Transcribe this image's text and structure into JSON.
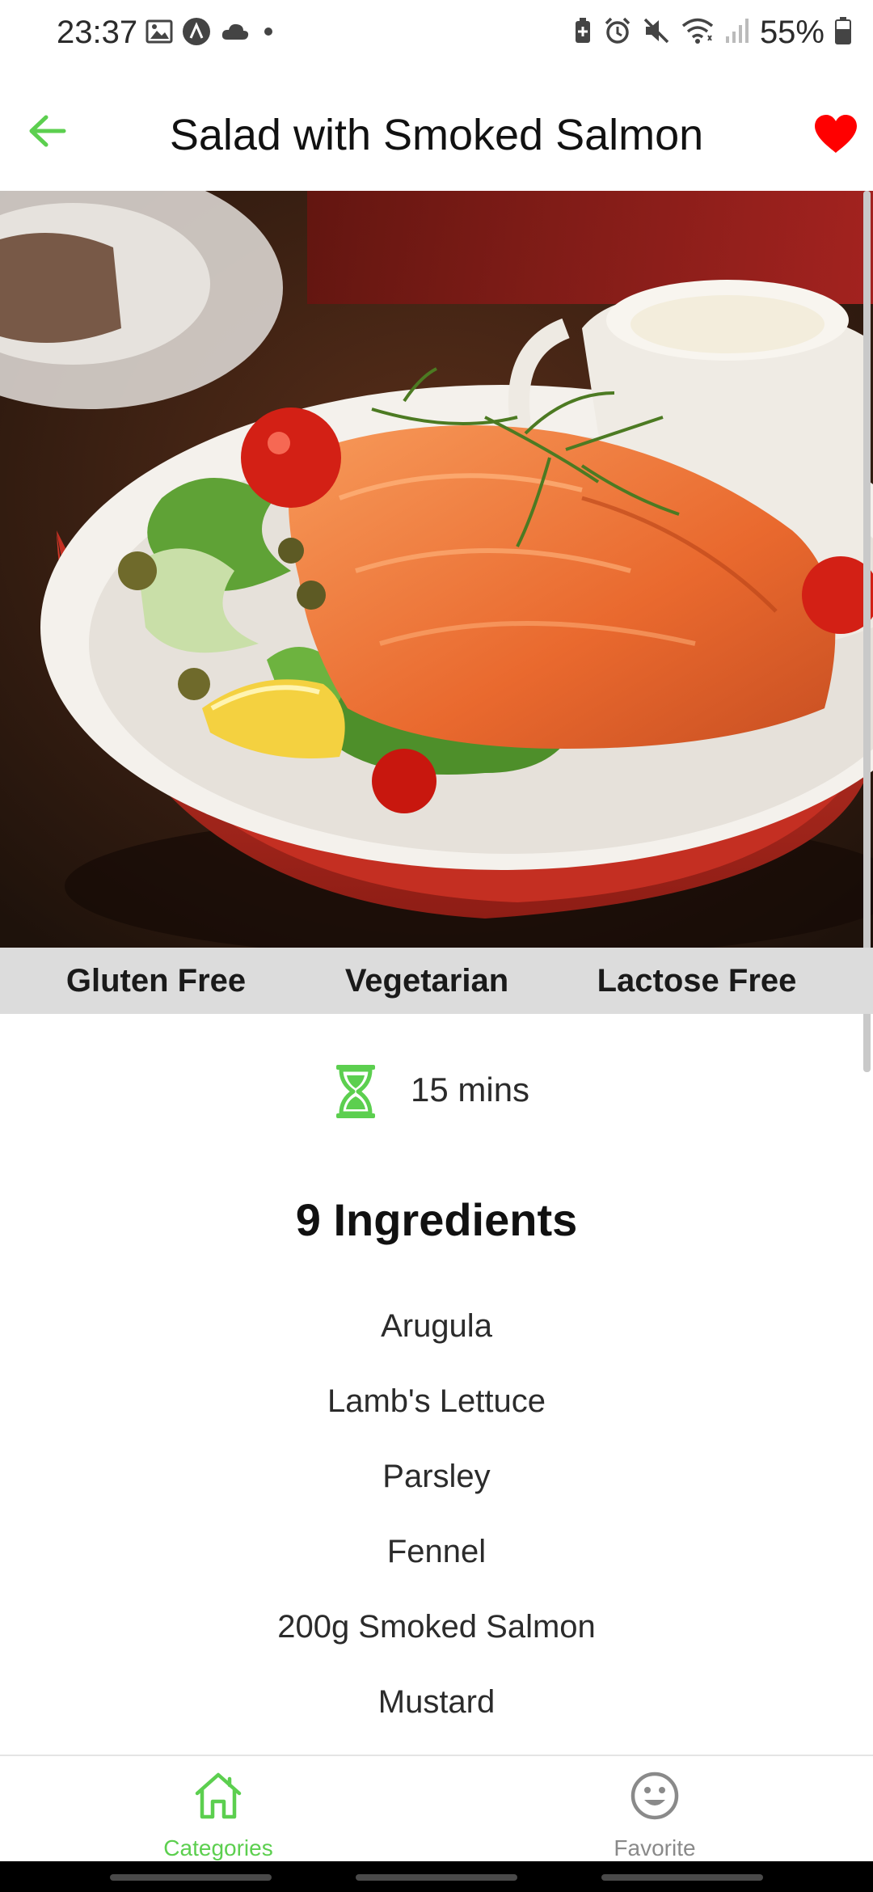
{
  "status_bar": {
    "time": "23:37",
    "battery_text": "55%",
    "left_icons": [
      "image-icon",
      "circle-a-icon",
      "cloud-icon",
      "dot-icon"
    ],
    "right_icons": [
      "battery-saver-icon",
      "alarm-icon",
      "mute-icon",
      "wifi-icon",
      "signal-icon",
      "battery-icon"
    ]
  },
  "app_bar": {
    "title": "Salad with Smoked Salmon",
    "back_icon": "arrow-left-icon",
    "favorite_icon": "heart-icon",
    "favorite_active": true
  },
  "tags": [
    "Gluten Free",
    "Vegetarian",
    "Lactose Free"
  ],
  "duration": {
    "icon": "hourglass-icon",
    "text": "15 mins"
  },
  "ingredients": {
    "title": "9 Ingredients",
    "items": [
      "Arugula",
      "Lamb's Lettuce",
      "Parsley",
      "Fennel",
      "200g Smoked Salmon",
      "Mustard"
    ]
  },
  "bottom_nav": [
    {
      "label": "Categories",
      "icon": "home-icon",
      "active": true
    },
    {
      "label": "Favorite",
      "icon": "smiley-icon",
      "active": false
    }
  ],
  "colors": {
    "accent": "#5ccf4f",
    "favorite": "#ff0000",
    "tag_band": "#dcdcdc",
    "inactive_nav": "#8a8a8a"
  }
}
